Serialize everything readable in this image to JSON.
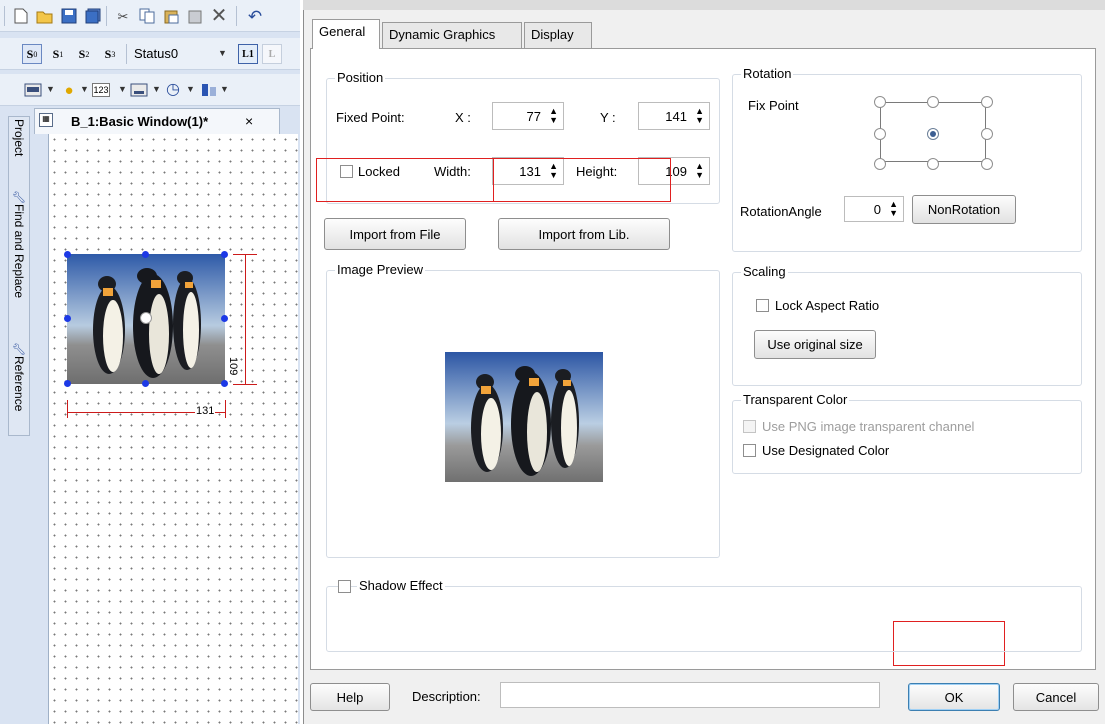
{
  "editor": {
    "toolbar1_icons": [
      "new-icon",
      "open-icon",
      "save-icon",
      "save-all-icon",
      "cut-icon",
      "copy-icon",
      "paste-icon",
      "paste-special-icon",
      "delete-icon",
      "undo-icon"
    ],
    "toolbar2": {
      "state_buttons": [
        {
          "base": "S",
          "sub": "0"
        },
        {
          "base": "S",
          "sub": "1"
        },
        {
          "base": "S",
          "sub": "2"
        },
        {
          "base": "S",
          "sub": "3"
        }
      ],
      "status_select": "Status0"
    },
    "toolbar3_icons": [
      "lamp-icon",
      "numeric-icon",
      "keypad-icon",
      "clock-icon",
      "meter-icon"
    ],
    "doc_tab": {
      "title": "B_1:Basic Window(1)*",
      "close": "×"
    },
    "side_tabs": [
      "Project",
      "Find and Replace",
      "Reference"
    ],
    "canvas": {
      "width_dim": "131",
      "height_dim": "109"
    }
  },
  "dialog": {
    "tabs": [
      "General",
      "Dynamic Graphics",
      "Display"
    ],
    "active_tab": "General",
    "position": {
      "title": "Position",
      "fixed_point_label": "Fixed Point:",
      "x_label": "X :",
      "x_value": "77",
      "y_label": "Y :",
      "y_value": "141",
      "locked_label": "Locked",
      "locked_checked": false,
      "width_label": "Width:",
      "width_value": "131",
      "height_label": "Height:",
      "height_value": "109"
    },
    "import_file_label": "Import from File",
    "import_lib_label": "Import from Lib.",
    "rotation": {
      "title": "Rotation",
      "fix_point_label": "Fix Point",
      "angle_label": "RotationAngle",
      "angle_value": "0",
      "nonrotation_label": "NonRotation"
    },
    "image_preview_title": "Image Preview",
    "scaling": {
      "title": "Scaling",
      "lock_aspect_label": "Lock Aspect Ratio",
      "use_original_label": "Use original size"
    },
    "transparent": {
      "title": "Transparent Color",
      "png_channel_label": "Use PNG image transparent channel",
      "designated_label": "Use Designated Color"
    },
    "shadow_label": "Shadow Effect",
    "help_label": "Help",
    "description_label": "Description:",
    "description_value": "",
    "ok_label": "OK",
    "cancel_label": "Cancel"
  },
  "colors": {
    "highlight_red": "#e02020",
    "handle_blue": "#1c39e6",
    "dimension_red": "#cc1b1b"
  }
}
